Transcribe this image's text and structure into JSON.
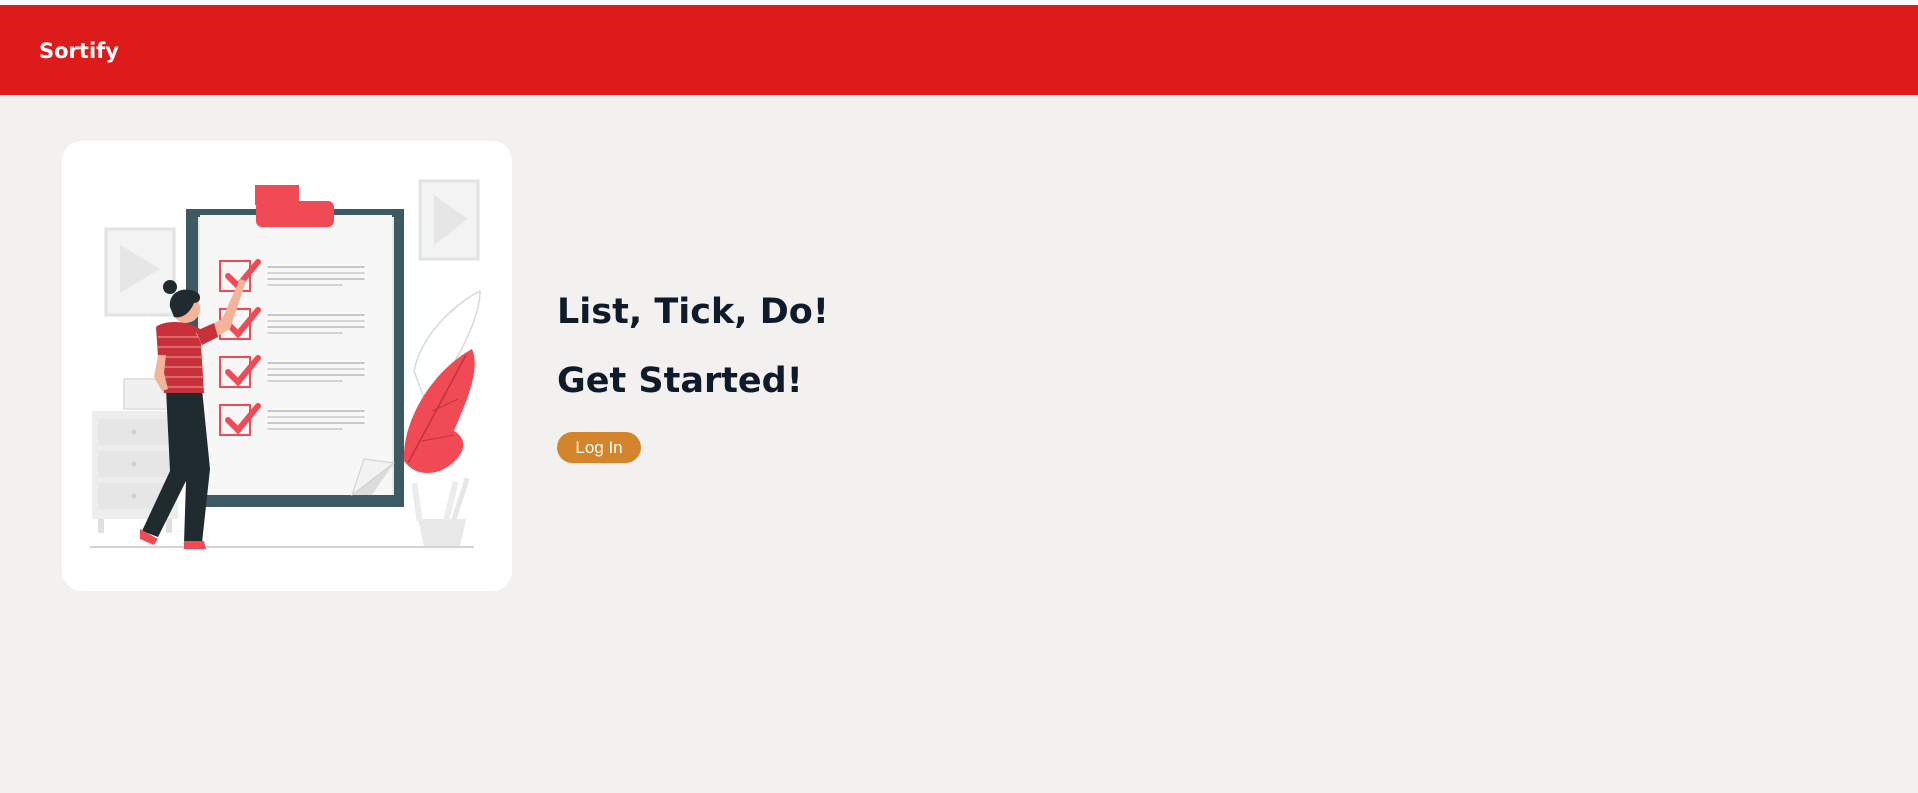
{
  "header": {
    "brand": "Sortify"
  },
  "hero": {
    "illustration_icon": "checklist-illustration",
    "headline": "List, Tick, Do!",
    "subline": "Get Started!",
    "login_label": "Log In"
  },
  "colors": {
    "navbar": "#dd1b1b",
    "page_background": "#f2f1ef",
    "button": "#d4842a",
    "heading_text": "#0f1b2a",
    "accent_red": "#f04b55"
  }
}
